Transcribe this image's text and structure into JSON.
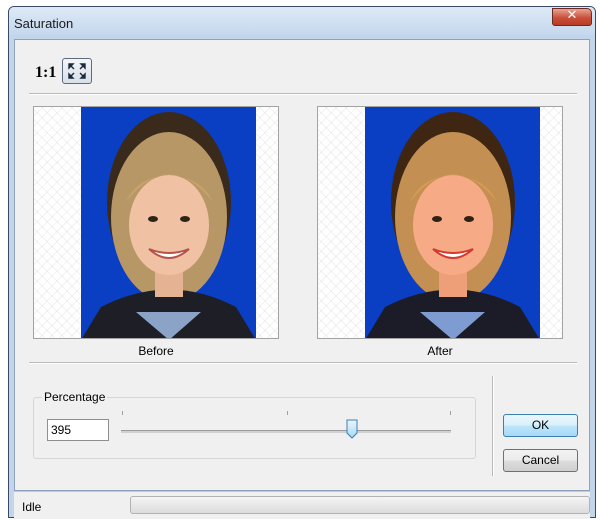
{
  "window": {
    "title": "Saturation",
    "close_icon": "close-icon"
  },
  "toolbar": {
    "zoom_label": "1:1",
    "fit_icon": "fit-to-window-icon"
  },
  "previews": {
    "before_caption": "Before",
    "after_caption": "After",
    "background_color": "#0a3fc4"
  },
  "percentage": {
    "label": "Percentage",
    "value": "395",
    "slider_level": 0.7
  },
  "buttons": {
    "ok": "OK",
    "cancel": "Cancel"
  },
  "status": {
    "text": "Idle",
    "progress": 0
  }
}
